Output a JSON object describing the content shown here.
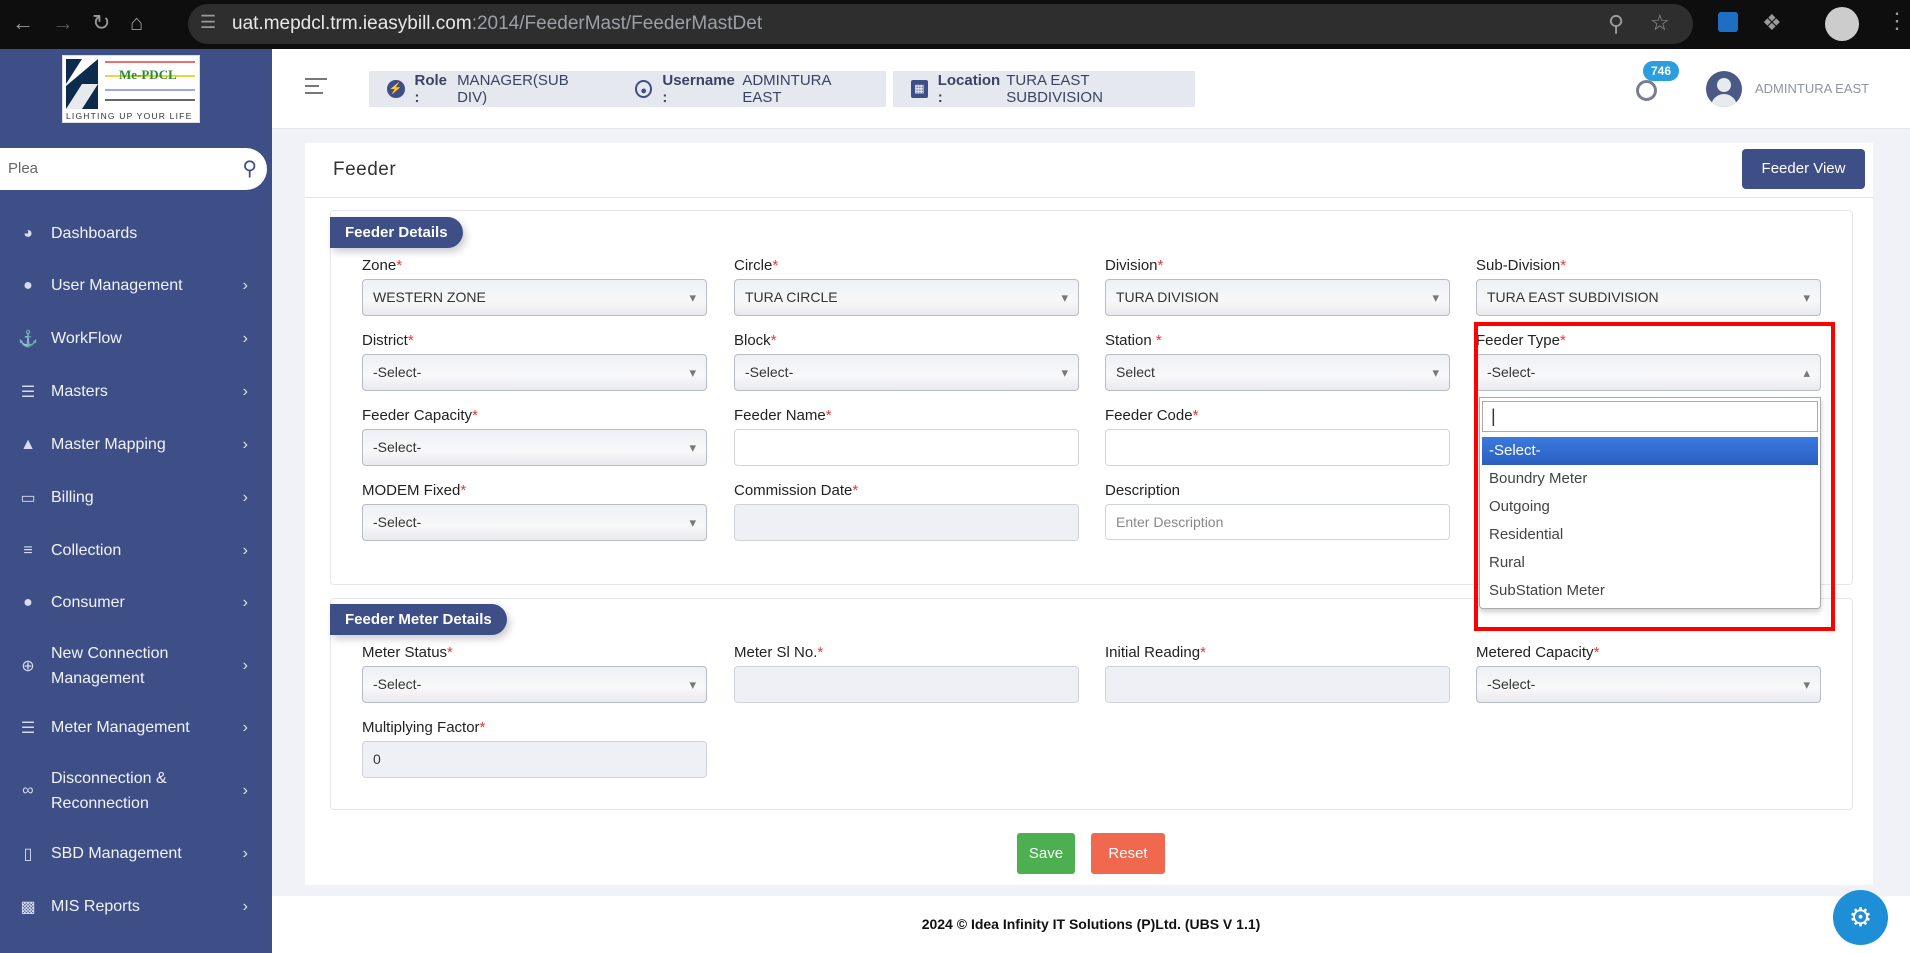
{
  "browser": {
    "url_host": "uat.mepdcl.trm.ieasybill.com",
    "url_path": ":2014/FeederMast/FeederMastDet"
  },
  "logo": {
    "name": "Me-PDCL",
    "tagline": "LIGHTING UP YOUR LIFE"
  },
  "sidebar": {
    "search_value": "Plea",
    "items": [
      {
        "label": "Dashboards",
        "icon": "dashboard-icon"
      },
      {
        "label": "User Management",
        "icon": "user-icon"
      },
      {
        "label": "WorkFlow",
        "icon": "anchor-icon"
      },
      {
        "label": "Masters",
        "icon": "server-icon"
      },
      {
        "label": "Master Mapping",
        "icon": "sitemap-icon"
      },
      {
        "label": "Billing",
        "icon": "monitor-icon"
      },
      {
        "label": "Collection",
        "icon": "list-icon"
      },
      {
        "label": "Consumer",
        "icon": "user-icon"
      },
      {
        "label": "New Connection Management",
        "icon": "plus-circle-icon"
      },
      {
        "label": "Meter Management",
        "icon": "server-icon"
      },
      {
        "label": "Disconnection & Reconnection",
        "icon": "link-icon"
      },
      {
        "label": "SBD Management",
        "icon": "mobile-icon"
      },
      {
        "label": "MIS Reports",
        "icon": "bar-chart-icon"
      }
    ]
  },
  "header": {
    "role_label": "Role :",
    "role": "MANAGER(SUB DIV)",
    "username_label": "Username :",
    "username": "ADMINTURA EAST",
    "location_label": "Location :",
    "location": "TURA EAST SUBDIVISION",
    "notification_count": "746",
    "user_name": "ADMINTURA EAST"
  },
  "page": {
    "title": "Feeder",
    "view_button": "Feeder View"
  },
  "feeder_details": {
    "title": "Feeder Details",
    "fields": [
      {
        "label": "Zone",
        "value": "WESTERN ZONE"
      },
      {
        "label": "Circle",
        "value": "TURA CIRCLE"
      },
      {
        "label": "Division",
        "value": "TURA DIVISION"
      },
      {
        "label": "Sub-Division",
        "value": "TURA EAST SUBDIVISION"
      },
      {
        "label": "District",
        "value": "-Select-"
      },
      {
        "label": "Block",
        "value": "-Select-"
      },
      {
        "label": "Station ",
        "value": "Select"
      },
      {
        "label": "Feeder Type",
        "value": "-Select-"
      },
      {
        "label": "Feeder Capacity",
        "value": "-Select-"
      },
      {
        "label": "Feeder Name",
        "value": ""
      },
      {
        "label": "Feeder Code",
        "value": ""
      },
      {
        "label": "MODEM Fixed",
        "value": "-Select-"
      },
      {
        "label": "Commission Date",
        "value": ""
      },
      {
        "label": "Description",
        "placeholder": "Enter Description"
      }
    ]
  },
  "feeder_type_dropdown": {
    "search_value": "|",
    "options": [
      "-Select-",
      "Boundry Meter",
      "Outgoing",
      "Residential",
      "Rural",
      "SubStation Meter"
    ],
    "selected": "-Select-"
  },
  "meter_details": {
    "title": "Feeder Meter Details",
    "fields": [
      {
        "label": "Meter Status",
        "value": "-Select-"
      },
      {
        "label": "Meter Sl No.",
        "value": ""
      },
      {
        "label": "Initial Reading",
        "value": ""
      },
      {
        "label": "Metered Capacity",
        "value": "-Select-"
      },
      {
        "label": "Multiplying Factor",
        "value": "0"
      }
    ]
  },
  "actions": {
    "save": "Save",
    "reset": "Reset"
  },
  "footer": {
    "text": "2024 © Idea Infinity IT Solutions (P)Ltd. (UBS V 1.1)"
  },
  "colors": {
    "sidebar": "#3e4e87",
    "save": "#4caf50",
    "reset": "#f0694e",
    "highlight": "#ff0000"
  }
}
